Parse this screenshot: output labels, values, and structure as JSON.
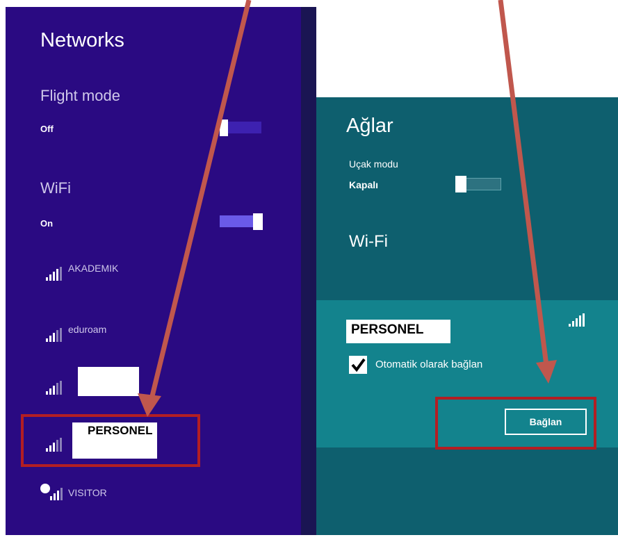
{
  "left": {
    "title": "Networks",
    "flight_mode": {
      "label": "Flight mode",
      "state": "Off"
    },
    "wifi": {
      "label": "WiFi",
      "state": "On"
    },
    "networks": [
      {
        "name": "AKADEMIK",
        "icon": "wifi-signal-icon"
      },
      {
        "name": "eduroam",
        "icon": "wifi-signal-icon"
      },
      {
        "name": "",
        "icon": "wifi-signal-icon"
      },
      {
        "name": "PERSONEL",
        "icon": "wifi-signal-icon"
      },
      {
        "name": "VISITOR",
        "icon": "wifi-shield-signal-icon"
      }
    ]
  },
  "right": {
    "title": "Ağlar",
    "flight_mode": {
      "label": "Uçak modu",
      "state": "Kapalı"
    },
    "wifi": {
      "label": "Wi-Fi"
    },
    "selected_network": {
      "name": "PERSONEL",
      "auto_connect_label": "Otomatik olarak bağlan",
      "auto_connect_checked": true,
      "connect_button": "Bağlan"
    }
  },
  "colors": {
    "left_bg": "#2a0a82",
    "right_bg": "#0e5f6e",
    "right_selected_bg": "#13838d",
    "highlight_red": "#b31e23",
    "arrow": "#c0574d"
  }
}
